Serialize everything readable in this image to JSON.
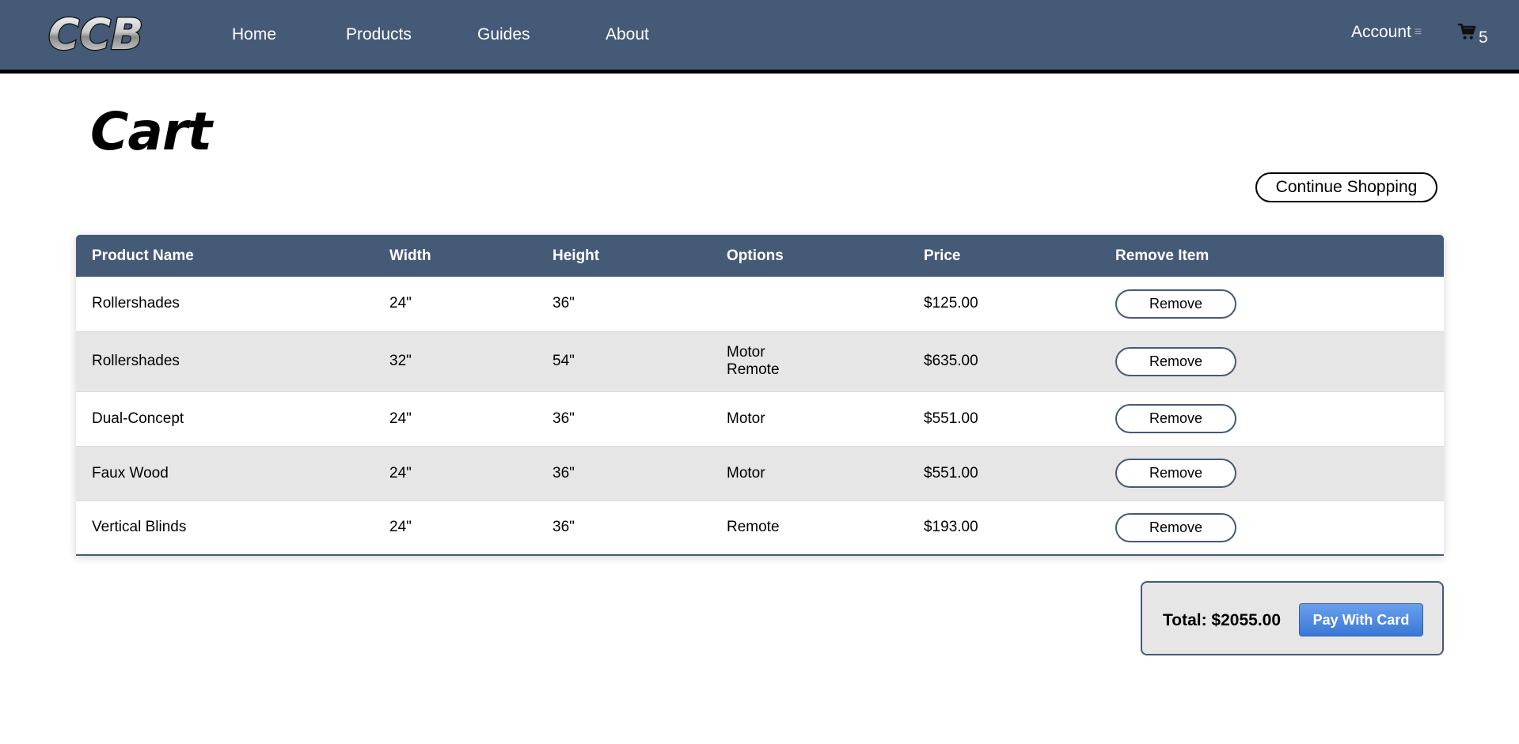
{
  "nav": {
    "logo_text": "CCB",
    "links": [
      "Home",
      "Products",
      "Guides",
      "About"
    ],
    "account_label": "Account",
    "account_menu_glyph": "≡",
    "cart_icon": "cart-icon",
    "cart_count": "5"
  },
  "page": {
    "title": "Cart",
    "continue_label": "Continue Shopping"
  },
  "table": {
    "headers": [
      "Product Name",
      "Width",
      "Height",
      "Options",
      "Price",
      "Remove Item"
    ],
    "remove_label": "Remove",
    "rows": [
      {
        "name": "Rollershades",
        "width": "24\"",
        "height": "36\"",
        "options": [],
        "price": "$125.00"
      },
      {
        "name": "Rollershades",
        "width": "32\"",
        "height": "54\"",
        "options": [
          "Motor",
          "Remote"
        ],
        "price": "$635.00"
      },
      {
        "name": "Dual-Concept",
        "width": "24\"",
        "height": "36\"",
        "options": [
          "Motor"
        ],
        "price": "$551.00"
      },
      {
        "name": "Faux Wood",
        "width": "24\"",
        "height": "36\"",
        "options": [
          "Motor"
        ],
        "price": "$551.00"
      },
      {
        "name": "Vertical Blinds",
        "width": "24\"",
        "height": "36\"",
        "options": [
          "Remote"
        ],
        "price": "$193.00"
      }
    ]
  },
  "checkout": {
    "total_text": "Total: $2055.00",
    "pay_label": "Pay With Card"
  },
  "colors": {
    "nav_bg": "#455a77",
    "row_alt": "#e6e6e6",
    "pay_button": "#3a78d6"
  }
}
